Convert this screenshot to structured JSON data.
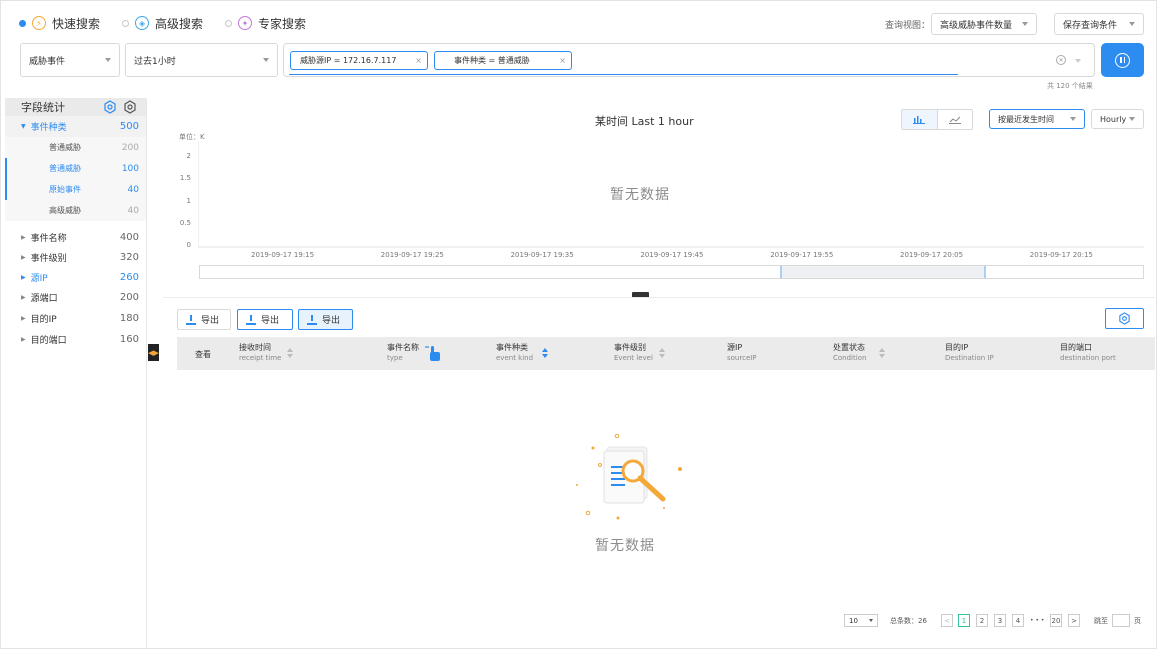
{
  "search_modes": [
    {
      "label": "快速搜索",
      "icon": "quick-search-icon",
      "selected": true
    },
    {
      "label": "高级搜索",
      "icon": "advanced-search-icon",
      "selected": false
    },
    {
      "label": "专家搜索",
      "icon": "expert-search-icon",
      "selected": false
    }
  ],
  "query_view": {
    "label": "查询视图：",
    "value": "高级威胁事件数量"
  },
  "save_query": "保存查询条件",
  "filters": {
    "event_type": "威胁事件",
    "time_range": "过去1小时"
  },
  "search_tags": [
    "威胁源IP = 172.16.7.117",
    "事件种类 = 普通威胁"
  ],
  "result_count": "共 120 个结果",
  "sidebar": {
    "title": "字段统计",
    "groups": [
      {
        "label": "事件种类",
        "count": "500",
        "expanded": true,
        "children": [
          {
            "label": "普通威胁",
            "count": "200",
            "selected": false
          },
          {
            "label": "普通威胁",
            "count": "100",
            "selected": true
          },
          {
            "label": "原始事件",
            "count": "40",
            "selected": true
          },
          {
            "label": "高级威胁",
            "count": "40",
            "selected": false
          }
        ]
      },
      {
        "label": "事件名称",
        "count": "400"
      },
      {
        "label": "事件级别",
        "count": "320"
      },
      {
        "label": "源IP",
        "count": "260",
        "highlight": true
      },
      {
        "label": "源端口",
        "count": "200"
      },
      {
        "label": "目的IP",
        "count": "180"
      },
      {
        "label": "目的端口",
        "count": "160"
      }
    ]
  },
  "chart": {
    "title": "某时间  Last 1 hour",
    "sort_select": "按最近发生时间",
    "interval_select": "Hourly",
    "unit_label": "单位：K",
    "empty_text": "暂无数据"
  },
  "chart_data": {
    "type": "bar",
    "title": "某时间  Last 1 hour",
    "ylabel": "单位：K",
    "ylim": [
      0,
      2
    ],
    "yticks": [
      "2",
      "1.5",
      "1",
      "0.5",
      "0"
    ],
    "xticks": [
      "2019-09-17  19:15",
      "2019-09-17  19:25",
      "2019-09-17  19:35",
      "2019-09-17  19:45",
      "2019-09-17  19:55",
      "2019-09-17  20:05",
      "2019-09-17  20:15"
    ],
    "series": []
  },
  "export_label": "导出",
  "table": {
    "view_col": "查看",
    "columns": [
      {
        "title": "接收时间",
        "sub": "receipt time",
        "sortable": true
      },
      {
        "title": "事件名称",
        "sub": "type",
        "sortable": false,
        "pointer": true
      },
      {
        "title": "事件种类",
        "sub": "event kind",
        "sortable": true,
        "active": true
      },
      {
        "title": "事件级别",
        "sub": "Event level",
        "sortable": true
      },
      {
        "title": "源IP",
        "sub": "sourceIP",
        "sortable": false
      },
      {
        "title": "处置状态",
        "sub": "Condition",
        "sortable": true
      },
      {
        "title": "目的IP",
        "sub": "Destination IP",
        "sortable": false
      },
      {
        "title": "目的端口",
        "sub": "destination port",
        "sortable": false
      }
    ],
    "empty_text": "暂无数据"
  },
  "pagination": {
    "page_size": "10",
    "total": "总条数：26",
    "pages": [
      "1",
      "2",
      "3",
      "4"
    ],
    "last_page": "20",
    "ellipsis": "• • •",
    "jump_label": "跳至",
    "page_suffix": "页"
  },
  "colors": {
    "accent": "#2d8cf0",
    "orange": "#f3a83a",
    "current_page": "#35c39e"
  }
}
